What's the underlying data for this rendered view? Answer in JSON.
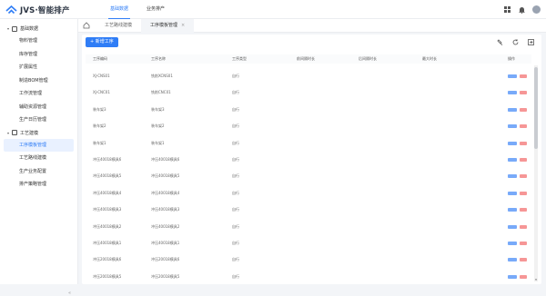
{
  "app": {
    "title": "JVS·智能排产"
  },
  "topnav": {
    "items": [
      "基础数据",
      "业务排产"
    ],
    "active_index": 0
  },
  "icons": {
    "apps": "grid-icon",
    "notifications": "bell-icon",
    "user": "avatar",
    "home": "home-icon",
    "refresh": "refresh-icon",
    "settings": "tool-settings-icon",
    "export": "export-icon"
  },
  "sidebar": {
    "groups": [
      {
        "label": "基础数据",
        "items": [
          "物料管理",
          "库存管理",
          "扩展属性",
          "制造BOM管理",
          "工作流管理",
          "辅助资源管理",
          "生产日历管理"
        ]
      },
      {
        "label": "工艺建模",
        "items": [
          "工序模板管理",
          "工艺路线建模",
          "生产业务配置",
          "排产策略管理"
        ]
      }
    ],
    "active_item": "工序模板管理"
  },
  "tabs": [
    {
      "label": "工艺路线建模"
    },
    {
      "label": "工序模板管理",
      "close": "×"
    }
  ],
  "toolbar": {
    "add_label": "+ 新增工序"
  },
  "table": {
    "columns": [
      "工序编码",
      "工序名称",
      "工序类型",
      "前间隔时长",
      "后间隔时长",
      "最大时长",
      "操作"
    ],
    "rows": [
      [
        "XJ-CNS01",
        "铣削XCNS01",
        "自行"
      ],
      [
        "XJ-CNC01",
        "铣削CNC01",
        "自行"
      ],
      [
        "装车架3",
        "装车架3",
        "自行"
      ],
      [
        "装车架2",
        "装车架2",
        "自行"
      ],
      [
        "装车架1",
        "装车架1",
        "自行"
      ],
      [
        "冲压40018模具6",
        "冲压40018模具6",
        "自行"
      ],
      [
        "冲压40018模具5",
        "冲压40018模具5",
        "自行"
      ],
      [
        "冲压40018模具4",
        "冲压40018模具4",
        "自行"
      ],
      [
        "冲压40018模具3",
        "冲压40018模具3",
        "自行"
      ],
      [
        "冲压40018模具2",
        "冲压40018模具2",
        "自行"
      ],
      [
        "冲压40018模具1",
        "冲压40018模具1",
        "自行"
      ],
      [
        "冲压20018模具6",
        "冲压20018模具6",
        "自行"
      ],
      [
        "冲压20018模具5",
        "冲压20018模具5",
        "自行"
      ]
    ]
  },
  "colors": {
    "accent": "#2f7df6",
    "danger": "#f47c7c"
  }
}
